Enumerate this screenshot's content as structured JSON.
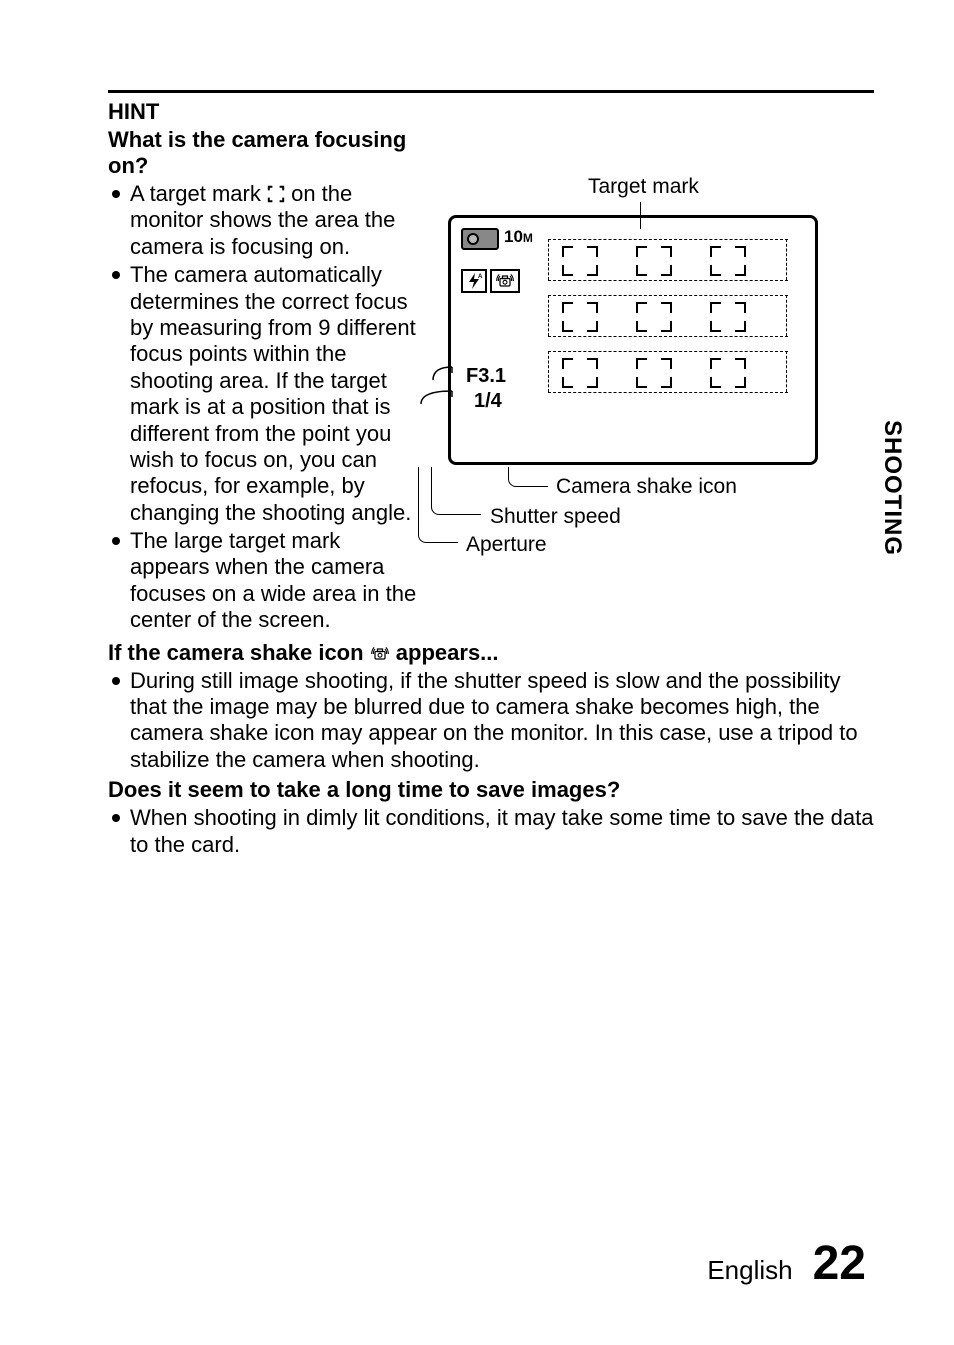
{
  "side_label": "SHOOTING",
  "hint_label": "HINT",
  "sections": {
    "focusing": {
      "heading": "What is the camera focusing on?",
      "b1_pre": "A target mark ",
      "b1_post": " on the monitor shows the area the camera is focusing on.",
      "b2": "The camera automatically determines the correct focus by measuring from 9 different focus points within the shooting area. If the target mark is at a position that is different from the point you wish to focus on, you can refocus, for example, by changing the shooting angle.",
      "b3": "The large target mark appears when the camera focuses on a wide area in the center of the screen."
    },
    "shake": {
      "heading_pre": "If the camera shake icon ",
      "heading_post": " appears...",
      "b1": "During still image shooting, if the shutter speed is slow and the possibility that the image may be blurred due to camera shake becomes high, the camera shake icon may appear on the monitor. In this case, use a tripod to stabilize the camera when shooting."
    },
    "save": {
      "heading": "Does it seem to take a long time to save images?",
      "b1": "When shooting in dimly lit conditions, it may take some time to save the data to the card."
    }
  },
  "diagram": {
    "title": "Target mark",
    "ten": "10",
    "ten_unit": "M",
    "aperture": "F3.1",
    "shutter": "1/4",
    "callouts": {
      "shake": "Camera shake icon",
      "shutter": "Shutter speed",
      "aperture": "Aperture"
    }
  },
  "footer": {
    "lang": "English",
    "page": "22"
  }
}
